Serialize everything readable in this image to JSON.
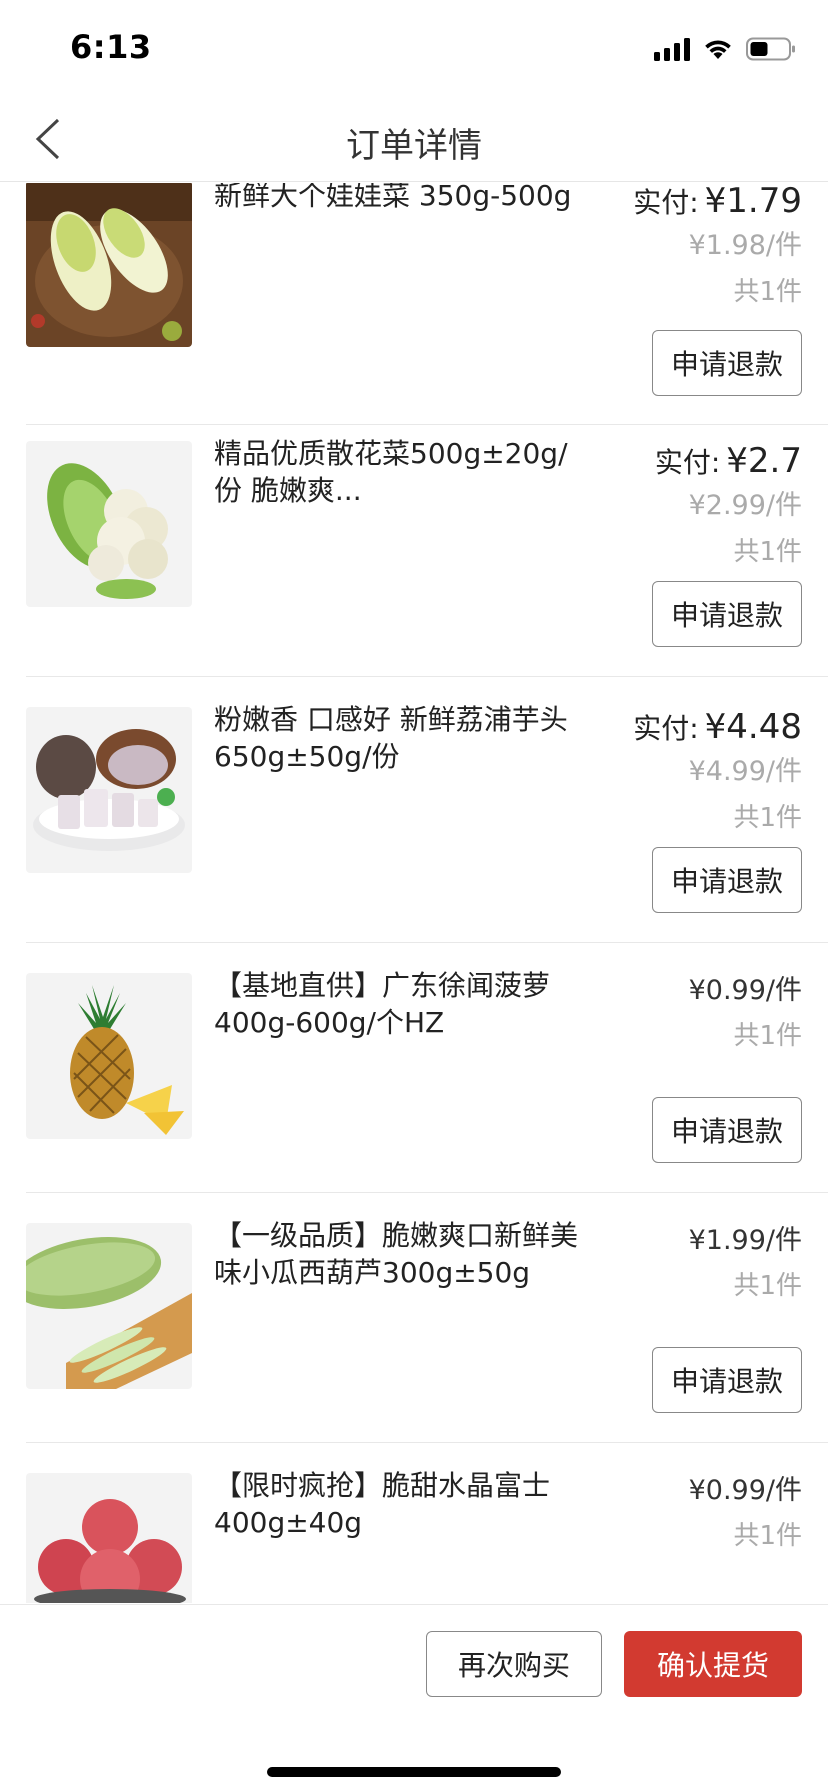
{
  "status_bar": {
    "time": "6:13",
    "icons": [
      "signal-icon",
      "wifi-icon",
      "battery-icon"
    ]
  },
  "nav": {
    "title": "订单详情",
    "back_icon": "chevron-left-icon"
  },
  "labels": {
    "paid_prefix": "实付:",
    "refund": "申请退款"
  },
  "items": [
    {
      "name": "新鲜大个娃娃菜 350g-500g",
      "paid": "¥1.79",
      "unit_price": "¥1.98/件",
      "qty": "共1件",
      "image": "napa-cabbage"
    },
    {
      "name": "精品优质散花菜500g±20g/份 脆嫩爽...",
      "paid": "¥2.7",
      "unit_price": "¥2.99/件",
      "qty": "共1件",
      "image": "cauliflower"
    },
    {
      "name": "粉嫩香 口感好 新鲜荔浦芋头 650g±50g/份",
      "paid": "¥4.48",
      "unit_price": "¥4.99/件",
      "qty": "共1件",
      "image": "taro"
    },
    {
      "name": "【基地直供】广东徐闻菠萝400g-600g/个HZ",
      "unit_price": "¥0.99/件",
      "qty": "共1件",
      "image": "pineapple"
    },
    {
      "name": "【一级品质】脆嫩爽口新鲜美味小瓜西葫芦300g±50g",
      "unit_price": "¥1.99/件",
      "qty": "共1件",
      "image": "zucchini"
    },
    {
      "name": "【限时疯抢】脆甜水晶富士400g±40g",
      "unit_price": "¥0.99/件",
      "qty": "共1件",
      "image": "fuji-apple"
    }
  ],
  "bottom": {
    "rebuy": "再次购买",
    "confirm": "确认提货"
  },
  "colors": {
    "accent": "#d23a30",
    "muted": "#aaaaaa"
  }
}
